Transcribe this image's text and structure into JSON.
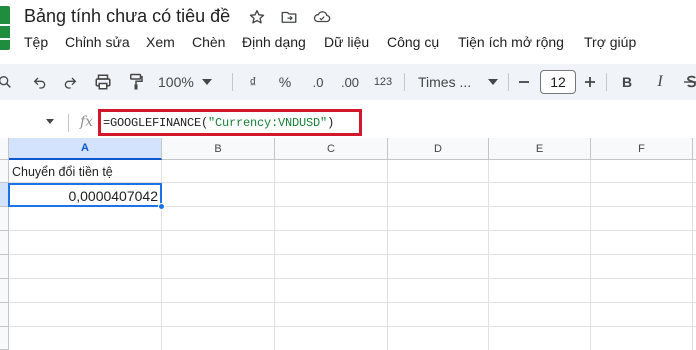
{
  "app": {
    "document_title": "Bảng tính chưa có tiêu đề"
  },
  "menu": {
    "items": [
      "Tệp",
      "Chỉnh sửa",
      "Xem",
      "Chèn",
      "Định dạng",
      "Dữ liệu",
      "Công cụ",
      "Tiện ích mở rộng",
      "Trợ giúp"
    ]
  },
  "toolbar": {
    "zoom": "100%",
    "currency_label": "₫",
    "percent_label": "%",
    "decrease_decimal_label": ".0",
    "increase_decimal_label": ".00",
    "number_format_label": "123",
    "font_name": "Times ...",
    "font_size": "12",
    "bold_label": "B",
    "italic_label": "I"
  },
  "formula_bar": {
    "fx_label": "fx",
    "formula_prefix": "=GOOGLEFINANCE(",
    "formula_string": "\"Currency:VNDUSD\"",
    "formula_suffix": ")"
  },
  "sheet": {
    "columns": [
      "A",
      "B",
      "C",
      "D",
      "E",
      "F"
    ],
    "selected_column": "A",
    "cells": {
      "A1": "Chuyển đổi tiền tệ",
      "A2": "0,0000407042"
    },
    "active_cell": "A2"
  },
  "colors": {
    "highlight_border": "#d0182a",
    "selection_blue": "#1a73e8",
    "toolbar_bg": "#f0f4f9",
    "sheets_green": "#1e8e3e"
  }
}
